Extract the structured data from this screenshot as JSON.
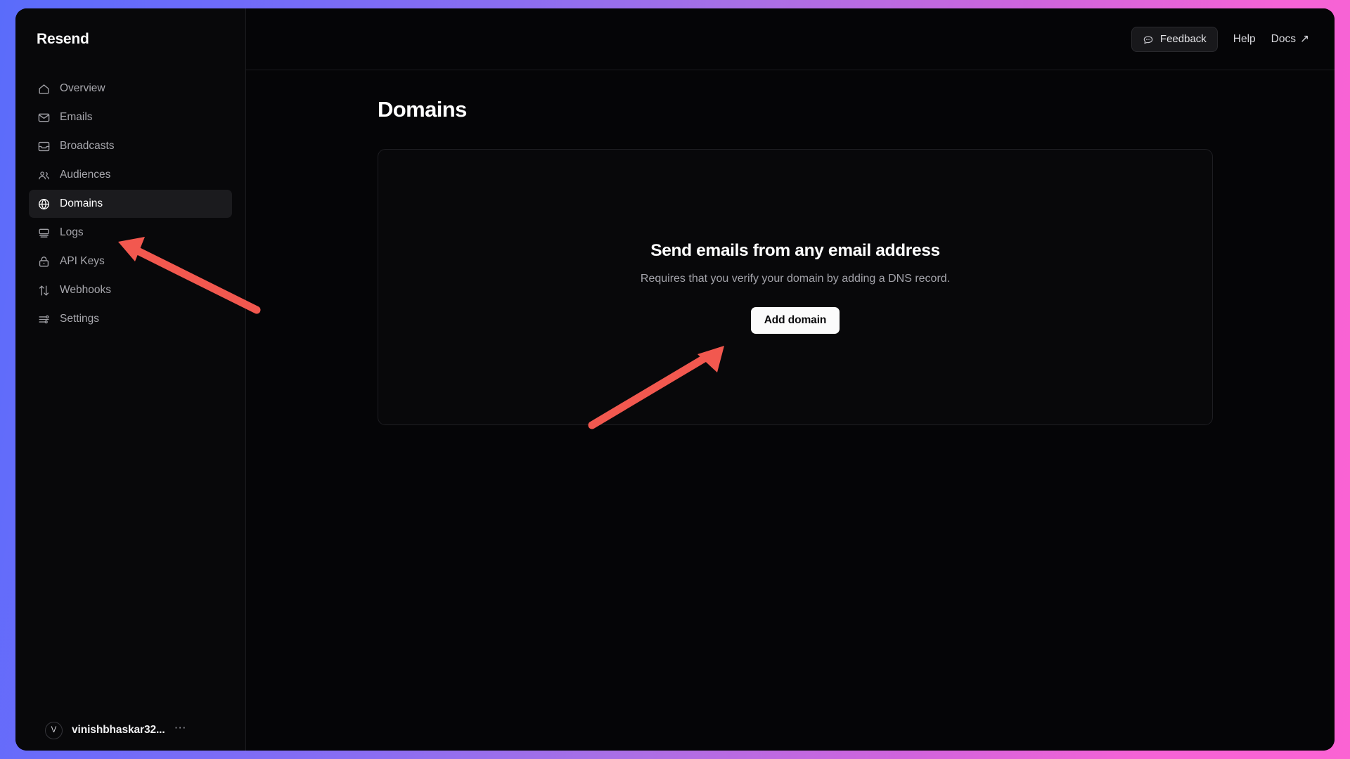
{
  "app": {
    "brand": "Resend"
  },
  "sidebar": {
    "items": [
      {
        "label": "Overview",
        "icon": "home-icon",
        "active": false
      },
      {
        "label": "Emails",
        "icon": "envelope-icon",
        "active": false
      },
      {
        "label": "Broadcasts",
        "icon": "inbox-icon",
        "active": false
      },
      {
        "label": "Audiences",
        "icon": "users-icon",
        "active": false
      },
      {
        "label": "Domains",
        "icon": "globe-icon",
        "active": true
      },
      {
        "label": "Logs",
        "icon": "logs-icon",
        "active": false
      },
      {
        "label": "API Keys",
        "icon": "lock-icon",
        "active": false
      },
      {
        "label": "Webhooks",
        "icon": "arrows-up-down-icon",
        "active": false
      },
      {
        "label": "Settings",
        "icon": "sliders-icon",
        "active": false
      }
    ],
    "account": {
      "avatar_initial": "V",
      "name": "vinishbhaskar32...",
      "more_glyph": "⋯",
      "more_icon": "ellipsis-icon"
    }
  },
  "topbar": {
    "feedback_label": "Feedback",
    "feedback_icon": "message-dots-icon",
    "help_label": "Help",
    "docs_label": "Docs",
    "docs_external_glyph": "↗"
  },
  "main": {
    "page_title": "Domains",
    "empty_state": {
      "heading": "Send emails from any email address",
      "subtext": "Requires that you verify your domain by adding a DNS record.",
      "button_label": "Add domain"
    }
  },
  "annotations": {
    "arrow_color": "#f2584f",
    "arrows": [
      {
        "name": "arrow-to-domains-nav",
        "points_to": "Domains"
      },
      {
        "name": "arrow-to-add-domain-button",
        "points_to": "Add domain"
      }
    ]
  },
  "colors": {
    "gradient_start": "#5a6cfa",
    "gradient_mid": "#a86fe6",
    "gradient_end": "#fb63d3",
    "window_background": "#050507",
    "sidebar_background": "#08080a",
    "active_item_background": "#1b1b1e",
    "border": "#1e1e22",
    "text_primary": "#ffffff",
    "text_muted": "#a3a3aa",
    "button_primary_bg": "#fbfbfb",
    "arrow_red": "#f2584f"
  }
}
